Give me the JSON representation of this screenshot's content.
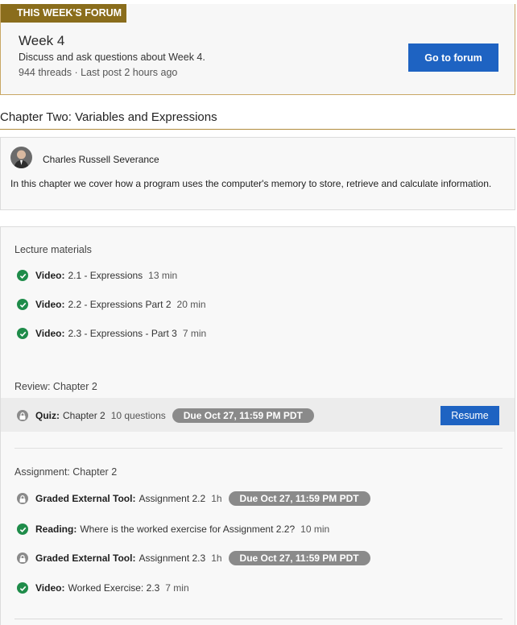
{
  "forum": {
    "badge": "THIS WEEK'S FORUM",
    "title": "Week 4",
    "description": "Discuss and ask questions about Week 4.",
    "meta": "944 threads · Last post 2 hours ago",
    "button_label": "Go to forum"
  },
  "chapter": {
    "title": "Chapter Two: Variables and Expressions",
    "instructor": "Charles Russell Severance",
    "description": "In this chapter we cover how a program uses the computer's memory to store, retrieve and calculate information."
  },
  "sections": {
    "lecture": {
      "label": "Lecture materials",
      "items": [
        {
          "kind": "Video:",
          "title": "2.1 - Expressions",
          "duration": "13 min",
          "status": "completed"
        },
        {
          "kind": "Video:",
          "title": "2.2 - Expressions Part 2",
          "duration": "20 min",
          "status": "completed"
        },
        {
          "kind": "Video:",
          "title": "2.3 - Expressions - Part 3",
          "duration": "7 min",
          "status": "completed"
        }
      ]
    },
    "review": {
      "label": "Review: Chapter 2",
      "quiz": {
        "kind": "Quiz:",
        "title": "Chapter 2",
        "duration": "10 questions",
        "due": "Due Oct 27, 11:59 PM PDT",
        "button_label": "Resume",
        "status": "locked"
      }
    },
    "assignment": {
      "label": "Assignment: Chapter 2",
      "items": [
        {
          "kind": "Graded External Tool:",
          "title": "Assignment 2.2",
          "duration": "1h",
          "due": "Due Oct 27, 11:59 PM PDT",
          "status": "locked"
        },
        {
          "kind": "Reading:",
          "title": "Where is the worked exercise for Assignment 2.2?",
          "duration": "10 min",
          "status": "completed"
        },
        {
          "kind": "Graded External Tool:",
          "title": "Assignment 2.3",
          "duration": "1h",
          "due": "Due Oct 27, 11:59 PM PDT",
          "status": "locked"
        },
        {
          "kind": "Video:",
          "title": "Worked Exercise: 2.3",
          "duration": "7 min",
          "status": "completed"
        }
      ]
    }
  },
  "colors": {
    "badge_bg": "#8a6d1c",
    "primary_button": "#1e63c2",
    "check_green": "#1f8c4a",
    "due_pill": "#8a8a8a"
  },
  "icons": {
    "completed": "check-circle-icon",
    "locked": "lock-icon"
  }
}
